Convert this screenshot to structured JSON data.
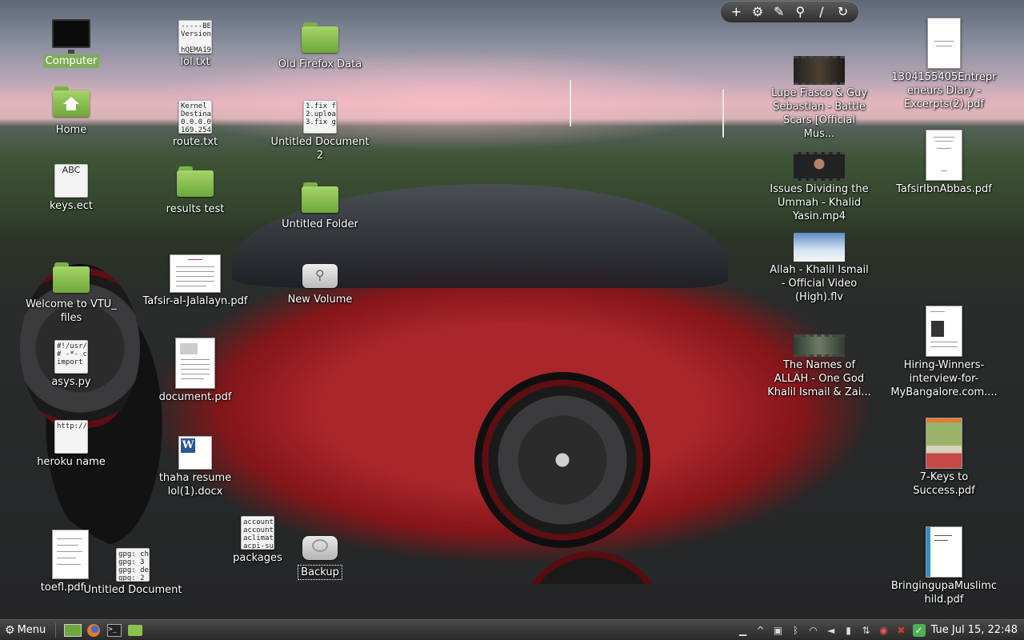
{
  "desktop": {
    "icons": {
      "computer": "Computer",
      "home": "Home",
      "keys": "keys.ect",
      "vtu": "Welcome to VTU_ files",
      "asys": "asys.py",
      "heroku": "heroku name",
      "toefl": "toefl.pdf",
      "untitled_doc": "Untitled Document",
      "lol_txt": "lol.txt",
      "route_txt": "route.txt",
      "results_test": "results test",
      "tafsir_jalalayn": "Tafsir-al-Jalalayn.pdf",
      "document_pdf": "document.pdf",
      "thaha_resume": "thaha resume lol(1).docx",
      "packages": "packages",
      "old_firefox": "Old Firefox Data",
      "untitled_doc2": "Untitled Document 2",
      "untitled_folder": "Untitled Folder",
      "new_volume": "New Volume",
      "backup": "Backup",
      "lupe": "Lupe Fiasco & Guy Sebastian - Battle Scars [Official Mus...",
      "issues": "Issues Dividing the Ummah - Khalid Yasin.mp4",
      "allah": "Allah - Khalil Ismail - Official Video (High).flv",
      "names": "The Names of ALLAH - One God Khalil Ismail & Zai...",
      "entrepreneurs": "1304155405Entrepreneurs Diary - Excerpts(2).pdf",
      "tafsir_ibn": "TafsirIbnAbbas.pdf",
      "hiring": "Hiring-Winners-interview-for-MyBangalore.com....",
      "seven_keys": "7-Keys to Success.pdf",
      "bringing": "BringingupaMuslimchild.pdf"
    },
    "thumbs": {
      "keys": "ABC",
      "asys": "#!/usr/\n# -*- c\nimport",
      "heroku": "http://",
      "untitled_doc": "gpg: ch\ngpg: 3\ngpg: de\ngpg: 2",
      "lol_txt": "-----BE\nVersion\n\nhQEMA19",
      "route_txt": "Kernel\nDestina\n0.0.0.0\n169.254",
      "packages": "account\naccount\naclimat\nacpi-su",
      "untitled_doc2": "1.fix f\n2.uploa\n3.fix g"
    }
  },
  "toolbar": {
    "add": "+",
    "settings": "⚙",
    "picker": "✎",
    "zoom": "⚲",
    "brush": "/",
    "refresh": "↻"
  },
  "taskbar": {
    "menu_label": "Menu",
    "clock": "Tue Jul 15, 22:48"
  }
}
